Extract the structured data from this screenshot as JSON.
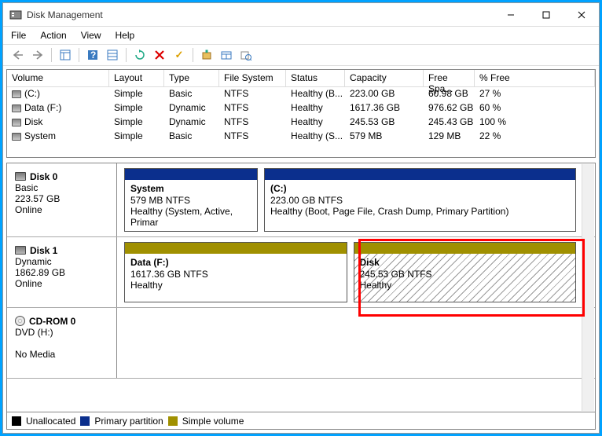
{
  "window": {
    "title": "Disk Management"
  },
  "menubar": [
    "File",
    "Action",
    "View",
    "Help"
  ],
  "columns": [
    "Volume",
    "Layout",
    "Type",
    "File System",
    "Status",
    "Capacity",
    "Free Spa...",
    "% Free"
  ],
  "volumes": [
    {
      "icon": "disk",
      "name": "(C:)",
      "layout": "Simple",
      "type": "Basic",
      "fs": "NTFS",
      "status": "Healthy (B...",
      "capacity": "223.00 GB",
      "free": "60.98 GB",
      "pfree": "27 %"
    },
    {
      "icon": "disk",
      "name": "Data (F:)",
      "layout": "Simple",
      "type": "Dynamic",
      "fs": "NTFS",
      "status": "Healthy",
      "capacity": "1617.36 GB",
      "free": "976.62 GB",
      "pfree": "60 %"
    },
    {
      "icon": "disk",
      "name": "Disk",
      "layout": "Simple",
      "type": "Dynamic",
      "fs": "NTFS",
      "status": "Healthy",
      "capacity": "245.53 GB",
      "free": "245.43 GB",
      "pfree": "100 %"
    },
    {
      "icon": "disk",
      "name": "System",
      "layout": "Simple",
      "type": "Basic",
      "fs": "NTFS",
      "status": "Healthy (S...",
      "capacity": "579 MB",
      "free": "129 MB",
      "pfree": "22 %"
    }
  ],
  "disks": [
    {
      "label": "Disk 0",
      "type": "Basic",
      "size": "223.57 GB",
      "state": "Online",
      "capcolor": "blue",
      "parts": [
        {
          "name": "System",
          "size": "579 MB NTFS",
          "status": "Healthy (System, Active, Primar",
          "hatched": false
        },
        {
          "name": " (C:)",
          "size": "223.00 GB NTFS",
          "status": "Healthy (Boot, Page File, Crash Dump, Primary Partition)",
          "hatched": false
        }
      ]
    },
    {
      "label": "Disk 1",
      "type": "Dynamic",
      "size": "1862.89 GB",
      "state": "Online",
      "capcolor": "olive",
      "parts": [
        {
          "name": "Data  (F:)",
          "size": "1617.36 GB NTFS",
          "status": "Healthy",
          "hatched": false
        },
        {
          "name": "Disk",
          "size": "245.53 GB NTFS",
          "status": "Healthy",
          "hatched": true
        }
      ]
    },
    {
      "label": "CD-ROM 0",
      "type": "DVD (H:)",
      "size": "",
      "state": "No Media",
      "cdrom": true
    }
  ],
  "legend": [
    {
      "color": "black",
      "label": "Unallocated"
    },
    {
      "color": "blue",
      "label": "Primary partition"
    },
    {
      "color": "olive",
      "label": "Simple volume"
    }
  ]
}
